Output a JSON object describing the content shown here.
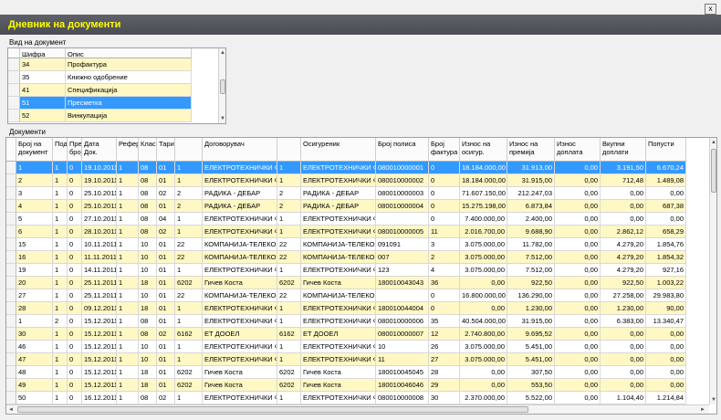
{
  "window": {
    "close_glyph": "x",
    "title": "Дневник на документи"
  },
  "doc_type": {
    "label": "Вид на документ",
    "headers": [
      "Шифра",
      "Опис"
    ],
    "rows": [
      {
        "code": "34",
        "desc": "Профактура",
        "style": "yellow"
      },
      {
        "code": "35",
        "desc": "Книжно одобрение",
        "style": "white"
      },
      {
        "code": "41",
        "desc": "Спецификација",
        "style": "yellow"
      },
      {
        "code": "51",
        "desc": "Пресметка",
        "style": "sel"
      },
      {
        "code": "52",
        "desc": "Винкулација",
        "style": "yellow"
      }
    ]
  },
  "documents": {
    "label": "Документи",
    "headers": [
      "Број на документ",
      "Под",
      "Пре број",
      "Дата Док.",
      "Рефер",
      "Класа",
      "Тари",
      "",
      "Договорувач",
      "",
      "Осигуреник",
      "Број полиса",
      "Број фактура",
      "Износ на осигур.",
      "Износ на премија",
      "Износ доплата",
      "Вкупни доплати",
      "Попусти"
    ],
    "rows": [
      {
        "style": "sel",
        "c": [
          "1",
          "1",
          "0",
          "19.10.2011",
          "1",
          "08",
          "01",
          "1",
          "ЕЛЕКТРОТЕХНИЧКИ Ф...",
          "1",
          "ЕЛЕКТРОТЕХНИЧКИ Ф...",
          "080010000001",
          "0",
          "18.184.000,00",
          "31.913,00",
          "0,00",
          "3.191,50",
          "6.670,24"
        ]
      },
      {
        "style": "yellow",
        "c": [
          "2",
          "1",
          "0",
          "19.10.2011",
          "1",
          "08",
          "01",
          "1",
          "ЕЛЕКТРОТЕХНИЧКИ Ф...",
          "1",
          "ЕЛЕКТРОТЕХНИЧКИ Ф...",
          "080010000002",
          "0",
          "18.184.000,00",
          "31.915,00",
          "0,00",
          "712,48",
          "1.489,08"
        ]
      },
      {
        "style": "white",
        "c": [
          "3",
          "1",
          "0",
          "25.10.2011",
          "1",
          "08",
          "02",
          "2",
          "РАДИКА - ДЕБАР",
          "2",
          "РАДИКА - ДЕБАР",
          "080010000003",
          "0",
          "71.607.150,00",
          "212.247,03",
          "0,00",
          "0,00",
          "0,00"
        ]
      },
      {
        "style": "yellow",
        "c": [
          "4",
          "1",
          "0",
          "25.10.2011",
          "1",
          "08",
          "01",
          "2",
          "РАДИКА - ДЕБАР",
          "2",
          "РАДИКА - ДЕБАР",
          "080010000004",
          "0",
          "15.275.198,00",
          "6.873,84",
          "0,00",
          "0,00",
          "687,38"
        ]
      },
      {
        "style": "white",
        "c": [
          "5",
          "1",
          "0",
          "27.10.2011",
          "1",
          "08",
          "04",
          "1",
          "ЕЛЕКТРОТЕХНИЧКИ Ф...",
          "1",
          "ЕЛЕКТРОТЕХНИЧКИ Ф...",
          "",
          "0",
          "7.400.000,00",
          "2.400,00",
          "0,00",
          "0,00",
          "0,00"
        ]
      },
      {
        "style": "yellow",
        "c": [
          "6",
          "1",
          "0",
          "28.10.2011",
          "1",
          "08",
          "02",
          "1",
          "ЕЛЕКТРОТЕХНИЧКИ Ф...",
          "1",
          "ЕЛЕКТРОТЕХНИЧКИ Ф...",
          "080010000005",
          "11",
          "2.016.700,00",
          "9.688,90",
          "0,00",
          "2.862,12",
          "658,29"
        ]
      },
      {
        "style": "white",
        "c": [
          "15",
          "1",
          "0",
          "10.11.2011",
          "1",
          "10",
          "01",
          "22",
          "КОМПАНИЈА-ТЕЛЕКОМ",
          "22",
          "КОМПАНИЈА-ТЕЛЕКОМ",
          "091091",
          "3",
          "3.075.000,00",
          "11.782,00",
          "0,00",
          "4.279,20",
          "1.854,76"
        ]
      },
      {
        "style": "yellow",
        "c": [
          "16",
          "1",
          "0",
          "11.11.2011",
          "1",
          "10",
          "01",
          "22",
          "КОМПАНИЈА-ТЕЛЕКОМ",
          "22",
          "КОМПАНИЈА-ТЕЛЕКОМ",
          "007",
          "2",
          "3.075.000,00",
          "7.512,00",
          "0,00",
          "4.279,20",
          "1.854,32"
        ]
      },
      {
        "style": "white",
        "c": [
          "19",
          "1",
          "0",
          "14.11.2011",
          "1",
          "10",
          "01",
          "1",
          "ЕЛЕКТРОТЕХНИЧКИ Ф...",
          "1",
          "ЕЛЕКТРОТЕХНИЧКИ Ф...",
          "123",
          "4",
          "3.075.000,00",
          "7.512,00",
          "0,00",
          "4.279,20",
          "927,16"
        ]
      },
      {
        "style": "yellow",
        "c": [
          "20",
          "1",
          "0",
          "25.11.2011",
          "1",
          "18",
          "01",
          "6202",
          "Гичев Коста",
          "6202",
          "Гичев Коста",
          "180010043043",
          "36",
          "0,00",
          "922,50",
          "0,00",
          "922,50",
          "1.003,22"
        ]
      },
      {
        "style": "white",
        "c": [
          "27",
          "1",
          "0",
          "25.11.2011",
          "1",
          "10",
          "01",
          "22",
          "КОМПАНИЈА-ТЕЛЕКОМ",
          "22",
          "КОМПАНИЈА-ТЕЛЕКОМ",
          "",
          "0",
          "16.800.000,00",
          "136.290,00",
          "0,00",
          "27.258,00",
          "29.983,80"
        ]
      },
      {
        "style": "yellow",
        "c": [
          "28",
          "1",
          "0",
          "09.12.2011",
          "1",
          "18",
          "01",
          "1",
          "ЕЛЕКТРОТЕХНИЧКИ Ф...",
          "1",
          "ЕЛЕКТРОТЕХНИЧКИ Ф...",
          "180010044004",
          "0",
          "0,00",
          "1.230,00",
          "0,00",
          "1.230,00",
          "90,00"
        ]
      },
      {
        "style": "white",
        "c": [
          "1",
          "2",
          "0",
          "15.12.2011",
          "1",
          "08",
          "01",
          "1",
          "ЕЛЕКТРОТЕХНИЧКИ Ф...",
          "1",
          "ЕЛЕКТРОТЕХНИЧКИ Ф...",
          "080010000006",
          "35",
          "40.504.000,00",
          "31.915,00",
          "0,00",
          "6.383,00",
          "13.340,47"
        ]
      },
      {
        "style": "yellow",
        "c": [
          "30",
          "1",
          "0",
          "15.12.2011",
          "1",
          "08",
          "02",
          "6162",
          "ЕТ ДООЕЛ",
          "6162",
          "ЕТ ДООЕЛ",
          "080010000007",
          "12",
          "2.740.800,00",
          "9.695,52",
          "0,00",
          "0,00",
          "0,00"
        ]
      },
      {
        "style": "white",
        "c": [
          "46",
          "1",
          "0",
          "15.12.2011",
          "1",
          "10",
          "01",
          "1",
          "ЕЛЕКТРОТЕХНИЧКИ Ф...",
          "1",
          "ЕЛЕКТРОТЕХНИЧКИ Ф...",
          "10",
          "26",
          "3.075.000,00",
          "5.451,00",
          "0,00",
          "0,00",
          "0,00"
        ]
      },
      {
        "style": "yellow",
        "c": [
          "47",
          "1",
          "0",
          "15.12.2011",
          "1",
          "10",
          "01",
          "1",
          "ЕЛЕКТРОТЕХНИЧКИ Ф...",
          "1",
          "ЕЛЕКТРОТЕХНИЧКИ Ф...",
          "11",
          "27",
          "3.075.000,00",
          "5.451,00",
          "0,00",
          "0,00",
          "0,00"
        ]
      },
      {
        "style": "white",
        "c": [
          "48",
          "1",
          "0",
          "15.12.2011",
          "1",
          "18",
          "01",
          "6202",
          "Гичев Коста",
          "6202",
          "Гичев Коста",
          "180010045045",
          "28",
          "0,00",
          "307,50",
          "0,00",
          "0,00",
          "0,00"
        ]
      },
      {
        "style": "yellow",
        "c": [
          "49",
          "1",
          "0",
          "15.12.2011",
          "1",
          "18",
          "01",
          "6202",
          "Гичев Коста",
          "6202",
          "Гичев Коста",
          "180010046046",
          "29",
          "0,00",
          "553,50",
          "0,00",
          "0,00",
          "0,00"
        ]
      },
      {
        "style": "white",
        "c": [
          "50",
          "1",
          "0",
          "16.12.2011",
          "1",
          "08",
          "02",
          "1",
          "ЕЛЕКТРОТЕХНИЧКИ Ф...",
          "1",
          "ЕЛЕКТРОТЕХНИЧКИ Ф...",
          "080010000008",
          "30",
          "2.370.000,00",
          "5.522,00",
          "0,00",
          "1.104,40",
          "1.214,84"
        ]
      }
    ]
  },
  "icons": {
    "scroll_up": "up-arrow-icon",
    "scroll_down": "down-arrow-icon",
    "scroll_left": "left-arrow-icon",
    "scroll_right": "right-arrow-icon"
  },
  "colors": {
    "selected": "#3399ff",
    "alt_row": "#fff8c4",
    "title_text": "#ffff00",
    "title_bar": "#55585e"
  }
}
